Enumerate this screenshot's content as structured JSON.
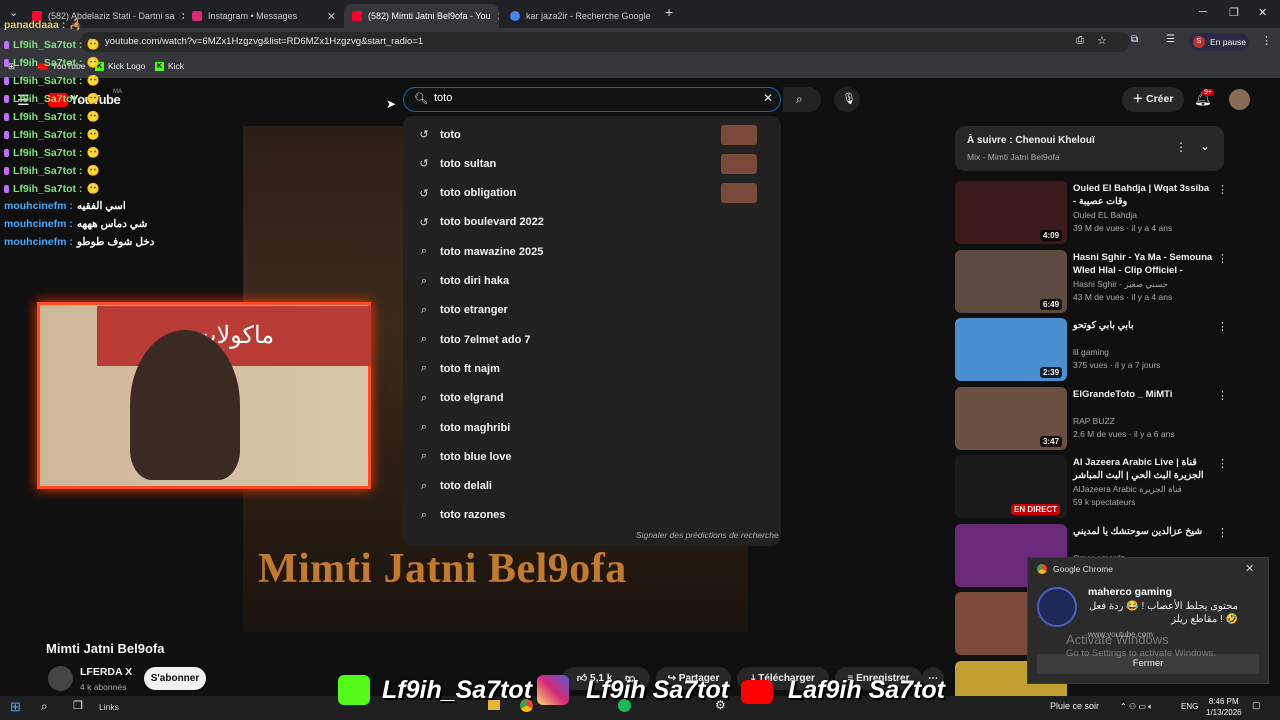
{
  "browser": {
    "tabs": [
      {
        "title": "(582) Abdelaziz Stati - Dartni sa",
        "color": "#ff0033"
      },
      {
        "title": "Instagram • Messages",
        "color": "#d62976"
      },
      {
        "title": "(582) Mimti Jatni Bel9ofa - You",
        "color": "#ff0033"
      },
      {
        "title": "kar jaza2ir - Recherche Google",
        "color": "#4285f4"
      }
    ],
    "url": "youtube.com/watch?v=6MZx1Hzgzvg&list=RD6MZx1Hzgzvg&start_radio=1",
    "profile_status": "En pause",
    "bookmarks": [
      "YouTube",
      "Kick Logo",
      "Kick"
    ]
  },
  "chat": [
    {
      "name": "panaddaaa :",
      "msg": "🦂"
    },
    {
      "name": "Lf9ih_Sa7tot :",
      "msg": "😶"
    },
    {
      "name": "Lf9ih_Sa7tot :",
      "msg": "😶"
    },
    {
      "name": "Lf9ih_Sa7tot :",
      "msg": "😶"
    },
    {
      "name": "Lf9ih_Sa7tot :",
      "msg": "😶"
    },
    {
      "name": "Lf9ih_Sa7tot :",
      "msg": "😶"
    },
    {
      "name": "Lf9ih_Sa7tot :",
      "msg": "😶"
    },
    {
      "name": "Lf9ih_Sa7tot :",
      "msg": "😶"
    },
    {
      "name": "Lf9ih_Sa7tot :",
      "msg": "😶"
    },
    {
      "name": "Lf9ih_Sa7tot :",
      "msg": "😶"
    },
    {
      "name": "mouhcinefm :",
      "msg": "اسي الفقيه"
    },
    {
      "name": "mouhcinefm :",
      "msg": "شي دماس هههه"
    },
    {
      "name": "mouhcinefm :",
      "msg": "دخل شوف طوطو"
    }
  ],
  "youtube": {
    "logo": "YouTube",
    "logo_region": "MA",
    "search_value": "toto",
    "create_label": "Créer",
    "notif_count": "9+",
    "suggestions": [
      "toto",
      "toto sultan",
      "toto obligation",
      "toto boulevard 2022",
      "toto mawazine 2025",
      "toto diri haka",
      "toto etranger",
      "toto 7elmet ado 7",
      "toto ft najm",
      "toto elgrand",
      "toto maghribi",
      "toto blue love",
      "toto delali",
      "toto razones"
    ],
    "report_label": "Signaler des prédictions de recherche",
    "video_art_text": "Mimti Jatni Bel9ofa",
    "cam_sign": "ماكولات",
    "video_title": "Mimti Jatni Bel9ofa",
    "channel": "LFERDA X",
    "subscribers": "4 k abonnés",
    "subscribe_label": "S'abonner",
    "likes": "5,1 k",
    "share_label": "Partager",
    "download_label": "Télécharger",
    "save_label": "Enregistrer",
    "up_next_title": "À suivre : Chenoui Khelouï",
    "up_next_sub": "Mix - Mimti Jatni Bel9ofa",
    "related": [
      {
        "title": "Ouled El Bahdja | Wqat 3ssiba - وقات عصيبة",
        "channel": "Ouled EL Bahdja",
        "meta": "39 M de vues · il y a 4 ans",
        "duration": "4:09",
        "color": "#3a1a1a"
      },
      {
        "title": "Hasni Sghir - Ya Ma - Semouna Wled Hlal - Clip Officiel -",
        "channel": "Hasni Sghir - حسني صغير",
        "meta": "43 M de vues · il y a 4 ans",
        "duration": "6:49",
        "color": "#5a4a40"
      },
      {
        "title": "بابي بابي كوتحو",
        "channel": "lil gaming",
        "meta": "375 vues · il y a 7 jours",
        "duration": "2:39",
        "color": "#4a8fd0"
      },
      {
        "title": "ElGrandeToto _ MiMTi",
        "channel": "RAP BUZZ",
        "meta": "2,6 M de vues · il y a 6 ans",
        "duration": "3:47",
        "color": "#6a5040"
      },
      {
        "title": "Al Jazeera Arabic Live | قناة الجزيرة البث الحي | البث المباشر",
        "channel": "AlJazeera Arabic قناة الجزيرة",
        "meta": "59 k spectateurs",
        "duration": "EN DIRECT",
        "color": "#1a1a1a"
      },
      {
        "title": "شيخ عزالدين سوحتشك يا لمديني",
        "channel": "Omar omardz",
        "meta": "",
        "duration": "",
        "color": "#6a2a7a"
      },
      {
        "title": "",
        "channel": "",
        "meta": "",
        "duration": "",
        "color": "#7a4a3a"
      },
      {
        "title": "Maroc vs -13/01/2026 بتاريخ",
        "channel": "",
        "meta": "",
        "duration": "",
        "color": "#c0a030"
      }
    ]
  },
  "banner": [
    "Lf9ih_Sa7tot",
    "Lf9ih Sa7tot",
    "Laf9ih Sa7tot"
  ],
  "notification": {
    "app": "Google Chrome",
    "title": "maherco gaming",
    "body": "محتوى يجلط الأعصاب ! 😂 ردة فعل مقاطع ريلز ! 🤣",
    "source": "www.youtube.com",
    "button": "Fermer"
  },
  "watermark": {
    "line1": "Activate Windows",
    "line2": "Go to Settings to activate Windows."
  },
  "taskbar": {
    "links": "Links",
    "weather": "Pluie ce soir",
    "lang": "ENG",
    "time": "8:46 PM",
    "date": "1/13/2026"
  }
}
